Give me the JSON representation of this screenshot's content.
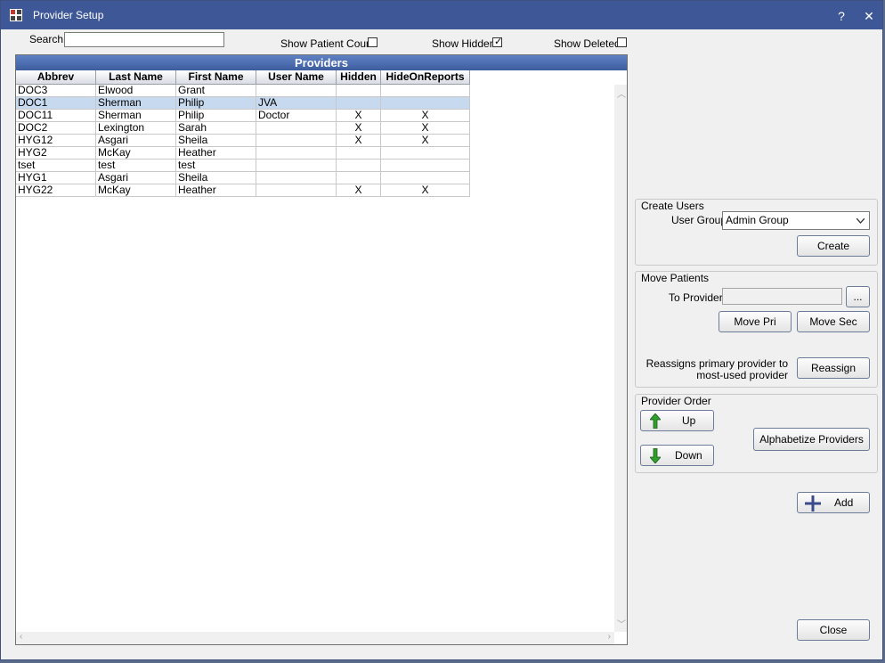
{
  "window": {
    "title": "Provider Setup",
    "help_label": "?",
    "close_label": "✕"
  },
  "filters": {
    "search_label": "Search",
    "search_value": "",
    "show_patient_count_label": "Show Patient Count",
    "show_patient_count_checked": false,
    "show_hidden_label": "Show Hidden",
    "show_hidden_checked": true,
    "show_deleted_label": "Show Deleted",
    "show_deleted_checked": false
  },
  "grid": {
    "title": "Providers",
    "columns": [
      "Abbrev",
      "Last Name",
      "First Name",
      "User Name",
      "Hidden",
      "HideOnReports"
    ],
    "rows": [
      {
        "cells": [
          "DOC3",
          "Elwood",
          "Grant",
          "",
          "",
          ""
        ],
        "selected": false
      },
      {
        "cells": [
          "DOC1",
          "Sherman",
          "Philip",
          "JVA",
          "",
          ""
        ],
        "selected": true
      },
      {
        "cells": [
          "DOC11",
          "Sherman",
          "Philip",
          "Doctor",
          "X",
          "X"
        ],
        "selected": false
      },
      {
        "cells": [
          "DOC2",
          "Lexington",
          "Sarah",
          "",
          "X",
          "X"
        ],
        "selected": false
      },
      {
        "cells": [
          "HYG12",
          "Asgari",
          "Sheila",
          "",
          "X",
          "X"
        ],
        "selected": false
      },
      {
        "cells": [
          "HYG2",
          "McKay",
          "Heather",
          "",
          "",
          ""
        ],
        "selected": false
      },
      {
        "cells": [
          "tset",
          "test",
          "test",
          "",
          "",
          ""
        ],
        "selected": false
      },
      {
        "cells": [
          "HYG1",
          "Asgari",
          "Sheila",
          "",
          "",
          ""
        ],
        "selected": false
      },
      {
        "cells": [
          "HYG22",
          "McKay",
          "Heather",
          "",
          "X",
          "X"
        ],
        "selected": false
      }
    ]
  },
  "create_users": {
    "title": "Create Users",
    "user_group_label": "User Group",
    "user_group_value": "Admin Group",
    "create_label": "Create"
  },
  "move_patients": {
    "title": "Move Patients",
    "to_provider_label": "To Provider",
    "to_provider_value": "",
    "browse_label": "...",
    "move_pri_label": "Move Pri",
    "move_sec_label": "Move Sec",
    "reassign_desc_line1": "Reassigns primary provider to",
    "reassign_desc_line2": "most-used provider",
    "reassign_label": "Reassign"
  },
  "provider_order": {
    "title": "Provider Order",
    "up_label": "Up",
    "down_label": "Down",
    "alphabetize_label": "Alphabetize Providers"
  },
  "actions": {
    "add_label": "Add",
    "close_label": "Close"
  },
  "colors": {
    "titlebar": "#3e5897",
    "grid_header": "#4a6bb0",
    "selected_row": "#c6d9ee",
    "arrow_green": "#2e9e2e",
    "add_plus": "#3a4a8a"
  }
}
